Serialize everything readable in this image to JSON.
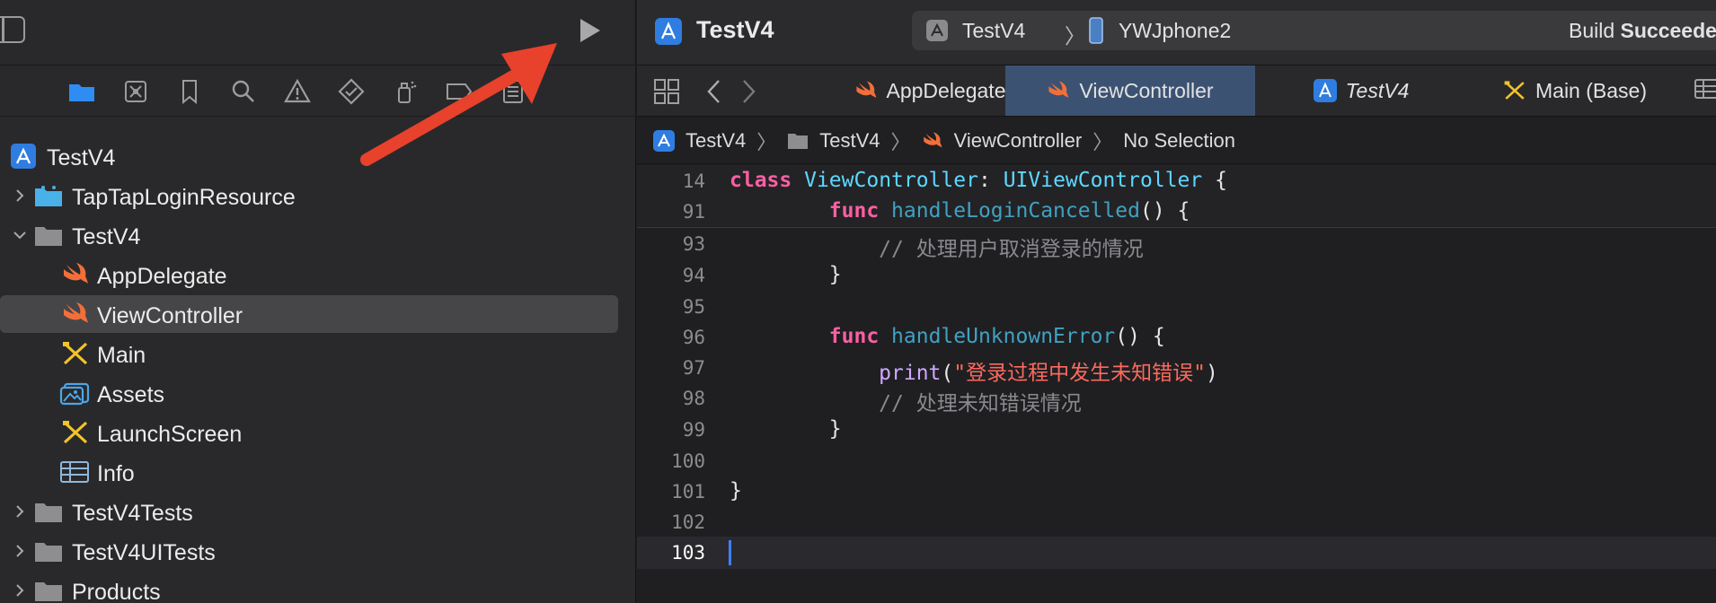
{
  "navigator": {
    "items": [
      {
        "label": "TestV4",
        "type": "project",
        "indent": 0,
        "disclosure": "none",
        "selected": false
      },
      {
        "label": "TapTapLoginResource",
        "type": "bundle-folder",
        "indent": 1,
        "disclosure": "collapsed",
        "selected": false
      },
      {
        "label": "TestV4",
        "type": "folder",
        "indent": 1,
        "disclosure": "expanded",
        "selected": false
      },
      {
        "label": "AppDelegate",
        "type": "swift",
        "indent": 2,
        "disclosure": "none",
        "selected": false
      },
      {
        "label": "ViewController",
        "type": "swift",
        "indent": 2,
        "disclosure": "none",
        "selected": true
      },
      {
        "label": "Main",
        "type": "storyboard",
        "indent": 2,
        "disclosure": "none",
        "selected": false
      },
      {
        "label": "Assets",
        "type": "assets",
        "indent": 2,
        "disclosure": "none",
        "selected": false
      },
      {
        "label": "LaunchScreen",
        "type": "storyboard",
        "indent": 2,
        "disclosure": "none",
        "selected": false
      },
      {
        "label": "Info",
        "type": "plist",
        "indent": 2,
        "disclosure": "none",
        "selected": false
      },
      {
        "label": "TestV4Tests",
        "type": "folder",
        "indent": 1,
        "disclosure": "collapsed",
        "selected": false
      },
      {
        "label": "TestV4UITests",
        "type": "folder",
        "indent": 1,
        "disclosure": "collapsed",
        "selected": false
      },
      {
        "label": "Products",
        "type": "folder",
        "indent": 1,
        "disclosure": "collapsed",
        "selected": false
      }
    ]
  },
  "toolbar": {
    "project_title": "TestV4",
    "scheme": "TestV4",
    "scheme_separator": "〉",
    "device": "YWJphone2",
    "build_status_prefix": "Build ",
    "build_status_bold": "Succeeded"
  },
  "tabs": [
    {
      "label": "AppDelegate",
      "icon": "swift-icon",
      "active": false,
      "italic": false
    },
    {
      "label": "ViewController",
      "icon": "swift-icon",
      "active": true,
      "italic": false
    },
    {
      "label": "TestV4",
      "icon": "app-project-icon",
      "active": false,
      "italic": true
    },
    {
      "label": "Main (Base)",
      "icon": "storyboard-icon",
      "active": false,
      "italic": false
    }
  ],
  "jumpbar": {
    "crumbs": [
      "TestV4",
      "TestV4",
      "ViewController",
      "No Selection"
    ],
    "separator": "〉"
  },
  "code": {
    "lines": [
      {
        "n": "14",
        "sticky": true
      },
      {
        "n": "91",
        "sticky": true
      },
      {
        "n": "93"
      },
      {
        "n": "94"
      },
      {
        "n": "95"
      },
      {
        "n": "96"
      },
      {
        "n": "97"
      },
      {
        "n": "98"
      },
      {
        "n": "99"
      },
      {
        "n": "100"
      },
      {
        "n": "101"
      },
      {
        "n": "102"
      },
      {
        "n": "103",
        "current": true
      }
    ],
    "tokens": {
      "l14_class": "class",
      "l14_name": "ViewController",
      "l14_colon": ": ",
      "l14_super": "UIViewController",
      "l14_brace": " {",
      "l91_func": "func",
      "l91_name": "handleLoginCancelled",
      "l91_rest": "() {",
      "l93_comment": "// 处理用户取消登录的情况",
      "l94_brace": "}",
      "l96_func": "func",
      "l96_name": "handleUnknownError",
      "l96_rest": "() {",
      "l97_print": "print",
      "l97_open": "(",
      "l97_string": "\"登录过程中发生未知错误\"",
      "l97_close": ")",
      "l98_comment": "// 处理未知错误情况",
      "l99_brace": "}",
      "l101_brace": "}"
    }
  },
  "colors": {
    "annotation_arrow": "#e8412c",
    "selection_tab": "#3c5272",
    "keyword": "#fc5fa3",
    "type": "#5dd8ff",
    "string": "#fc6a5d"
  }
}
